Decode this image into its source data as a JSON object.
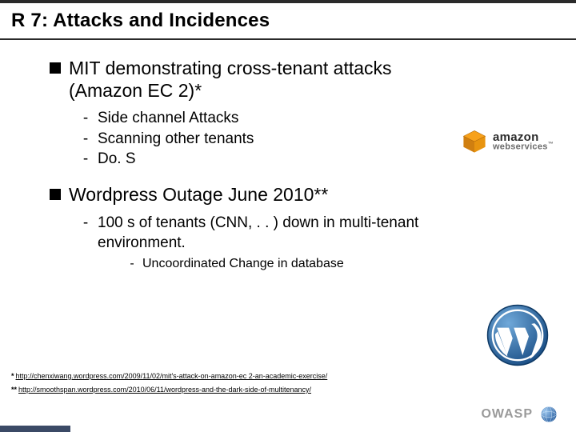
{
  "title": "R 7: Attacks and Incidences",
  "section1": {
    "heading": "MIT demonstrating cross-tenant attacks (Amazon EC 2)*",
    "items": [
      "Side channel Attacks",
      "Scanning other tenants",
      "Do. S"
    ]
  },
  "section2": {
    "heading": "Wordpress Outage June 2010**",
    "items": [
      "100 s of tenants (CNN, . . ) down in multi-tenant environment."
    ],
    "subitems": [
      "Uncoordinated Change in database"
    ]
  },
  "refs": {
    "r1_label": "*",
    "r1_url": "http://chenxiwang.wordpress.com/2009/11/02/mit's-attack-on-amazon-ec 2-an-academic-exercise/",
    "r2_label": "**",
    "r2_url": "http://smoothspan.wordpress.com/2010/06/11/wordpress-and-the-dark-side-of-multitenancy/"
  },
  "logos": {
    "aws_line1": "amazon",
    "aws_line2": "webservices",
    "aws_tm": "™",
    "wp_alt": "WordPress logo",
    "globe_alt": "globe icon"
  },
  "footer": {
    "brand": "OWASP"
  }
}
